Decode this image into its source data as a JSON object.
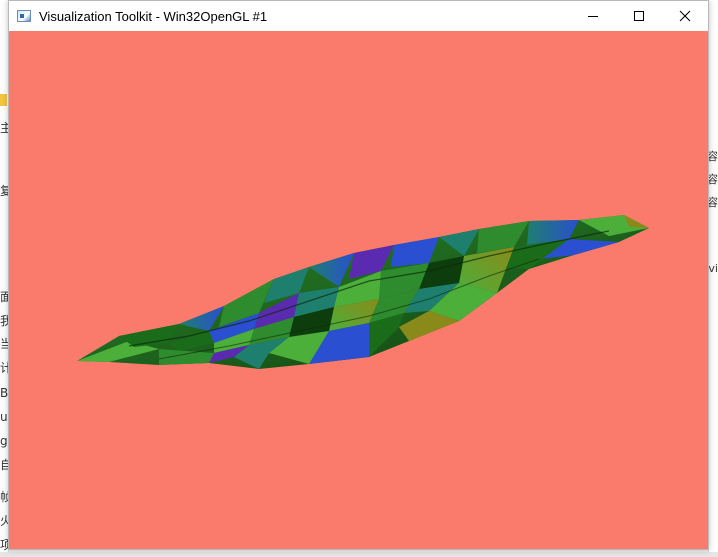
{
  "window": {
    "title": "Visualization Toolkit - Win32OpenGL #1",
    "background_color": "#fa7b6c",
    "controls": {
      "minimize_icon": "minimize-icon",
      "maximize_icon": "maximize-icon",
      "close_icon": "close-icon"
    }
  },
  "background_app": {
    "left_glyphs": [
      "主",
      "复",
      "面",
      "我",
      "当",
      "计",
      "B",
      "u",
      "g",
      "自",
      "帧",
      "火",
      "项"
    ],
    "right_glyphs": [
      "容",
      "容",
      "容",
      "vi"
    ]
  },
  "scene": {
    "object": "3d-terrain-surface",
    "colors": [
      "#1a6b1a",
      "#2e8b2e",
      "#4caf3a",
      "#1e7f6e",
      "#2a4fd0",
      "#5a2bb0",
      "#8a8a1a",
      "#0d3d0d"
    ]
  }
}
